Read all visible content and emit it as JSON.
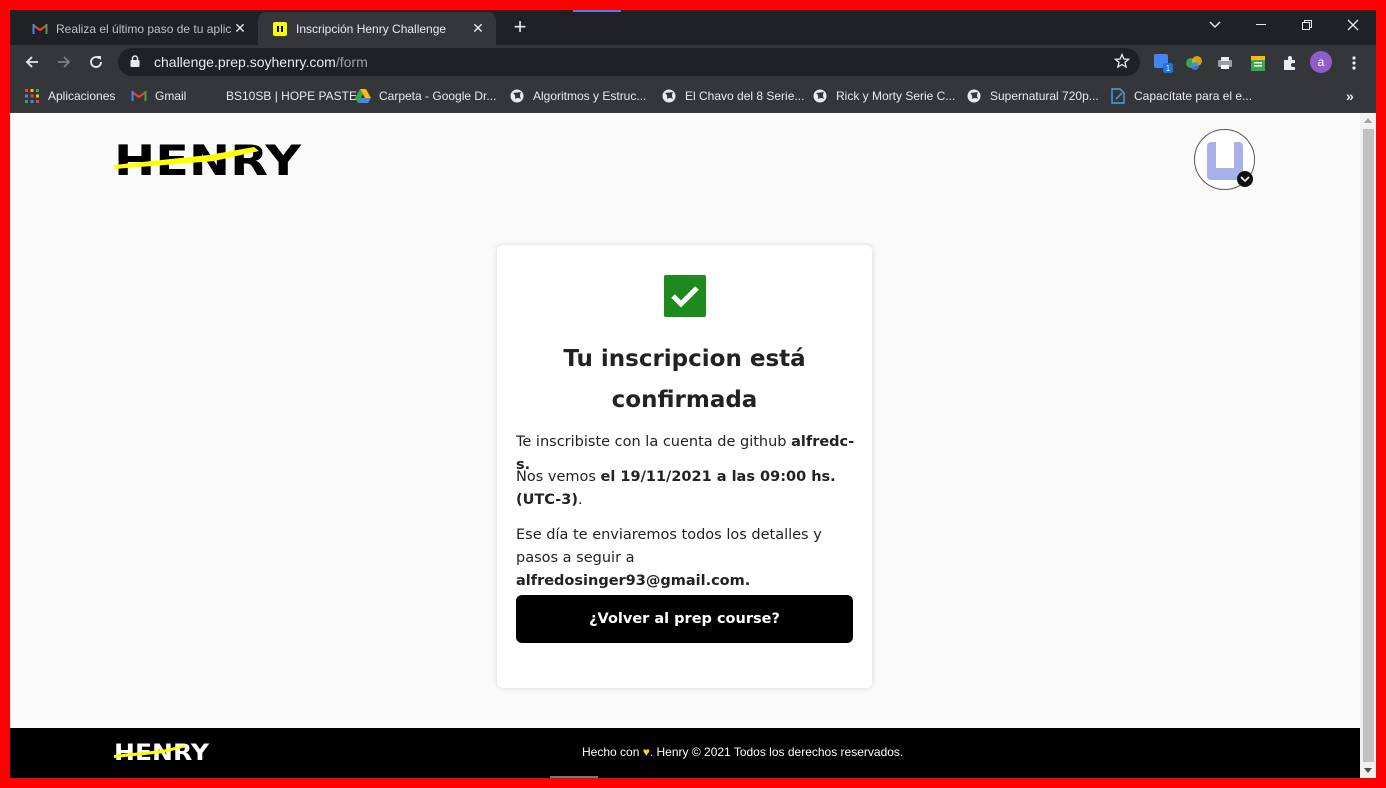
{
  "browser": {
    "tabs": [
      {
        "title": "Realiza el último paso de tu aplicación",
        "icon": "gmail-icon",
        "active": false
      },
      {
        "title": "Inscripción Henry Challenge",
        "icon": "henry-icon",
        "active": true
      }
    ],
    "url": {
      "host": "challenge.prep.soyhenry.com",
      "path": "/form"
    },
    "profile_initial": "a",
    "ext_badge": "1",
    "bookmarks": [
      {
        "label": "Aplicaciones",
        "icon": "apps-grid-icon"
      },
      {
        "label": "Gmail",
        "icon": "gmail-icon"
      },
      {
        "label": "BS10SB | HOPE PASTE",
        "icon": "blank-icon"
      },
      {
        "label": "Carpeta - Google Dr...",
        "icon": "google-drive-icon"
      },
      {
        "label": "Algoritmos y Estruc...",
        "icon": "globe-icon"
      },
      {
        "label": "El Chavo del 8 Serie...",
        "icon": "globe-icon"
      },
      {
        "label": "Rick y Morty Serie C...",
        "icon": "globe-icon"
      },
      {
        "label": "Supernatural 720p...",
        "icon": "globe-icon"
      },
      {
        "label": "Capacítate para el e...",
        "icon": "page-icon"
      }
    ]
  },
  "page": {
    "logo_text": "HENRY",
    "card": {
      "title": "Tu inscripcion está confirmada",
      "line1_prefix": "Te inscribiste con la cuenta de github ",
      "github_user": "alfredc-s.",
      "line2_prefix": "Nos vemos ",
      "date_text": "el 19/11/2021 a las 09:00 hs. (UTC-3)",
      "line2_suffix": ".",
      "line3_prefix": "Ese día te enviaremos todos los detalles y pasos a seguir a ",
      "email": "alfredosinger93@gmail.com.",
      "button_label": "¿Volver al prep course?"
    },
    "footer": {
      "text_before": "Hecho con ",
      "text_after": ". Henry © 2021 Todos los derechos reservados."
    }
  },
  "colors": {
    "accent_yellow": "#ffff01",
    "check_green": "#1e8a1e",
    "button_black": "#000000",
    "profile_purple": "#8e5ec7"
  }
}
